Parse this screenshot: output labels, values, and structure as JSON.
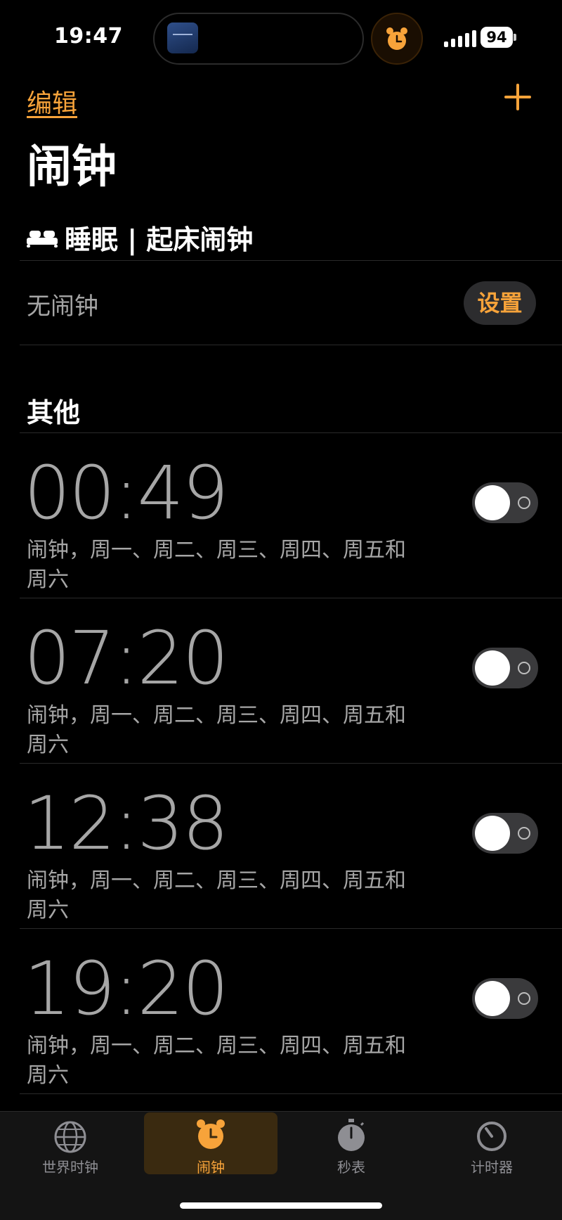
{
  "status_bar": {
    "time": "19:47",
    "battery": "94"
  },
  "header": {
    "edit_label": "编辑",
    "title": "闹钟"
  },
  "sleep": {
    "heading": "睡眠 | 起床闹钟",
    "status": "无闹钟",
    "setup_label": "设置"
  },
  "others": {
    "heading": "其他",
    "alarms": [
      {
        "time": "00:49",
        "label": "闹钟，周一、周二、周三、周四、周五和周六",
        "enabled": false
      },
      {
        "time": "07:20",
        "label": "闹钟，周一、周二、周三、周四、周五和周六",
        "enabled": false
      },
      {
        "time": "12:38",
        "label": "闹钟，周一、周二、周三、周四、周五和周六",
        "enabled": false
      },
      {
        "time": "19:20",
        "label": "闹钟，周一、周二、周三、周四、周五和周六",
        "enabled": false
      }
    ]
  },
  "tabs": [
    {
      "label": "世界时钟",
      "icon": "globe-icon",
      "active": false
    },
    {
      "label": "闹钟",
      "icon": "alarm-clock-icon",
      "active": true
    },
    {
      "label": "秒表",
      "icon": "stopwatch-icon",
      "active": false
    },
    {
      "label": "计时器",
      "icon": "timer-icon",
      "active": false
    }
  ],
  "colors": {
    "accent": "#f7a33a",
    "background": "#000000",
    "secondary_text": "#a6a6a6"
  }
}
